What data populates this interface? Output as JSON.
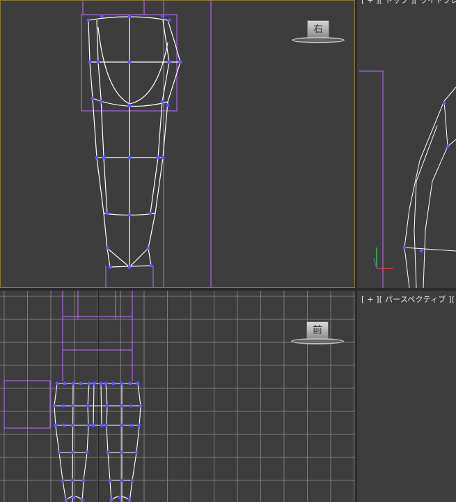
{
  "viewports": {
    "top_left": {
      "label": "",
      "viewcube_face": "右"
    },
    "top_right": {
      "label": "[ + ][ トップ ][ ワイヤフレーム"
    },
    "bottom_left": {
      "label": "",
      "viewcube_face": "前"
    },
    "bottom_right": {
      "label": "[ + ][ パースペクティブ ][ リアリスティック ]"
    }
  },
  "colors": {
    "viewport_bg": "#3d3d3d",
    "active_border": "#8a7a3a",
    "wire": "#ffffff",
    "vertex": "#5a5aff",
    "gizmo": "#c070ff",
    "grid": "#8a8a8a"
  },
  "icons": {
    "axis_tripod": "axis-tripod-icon"
  }
}
